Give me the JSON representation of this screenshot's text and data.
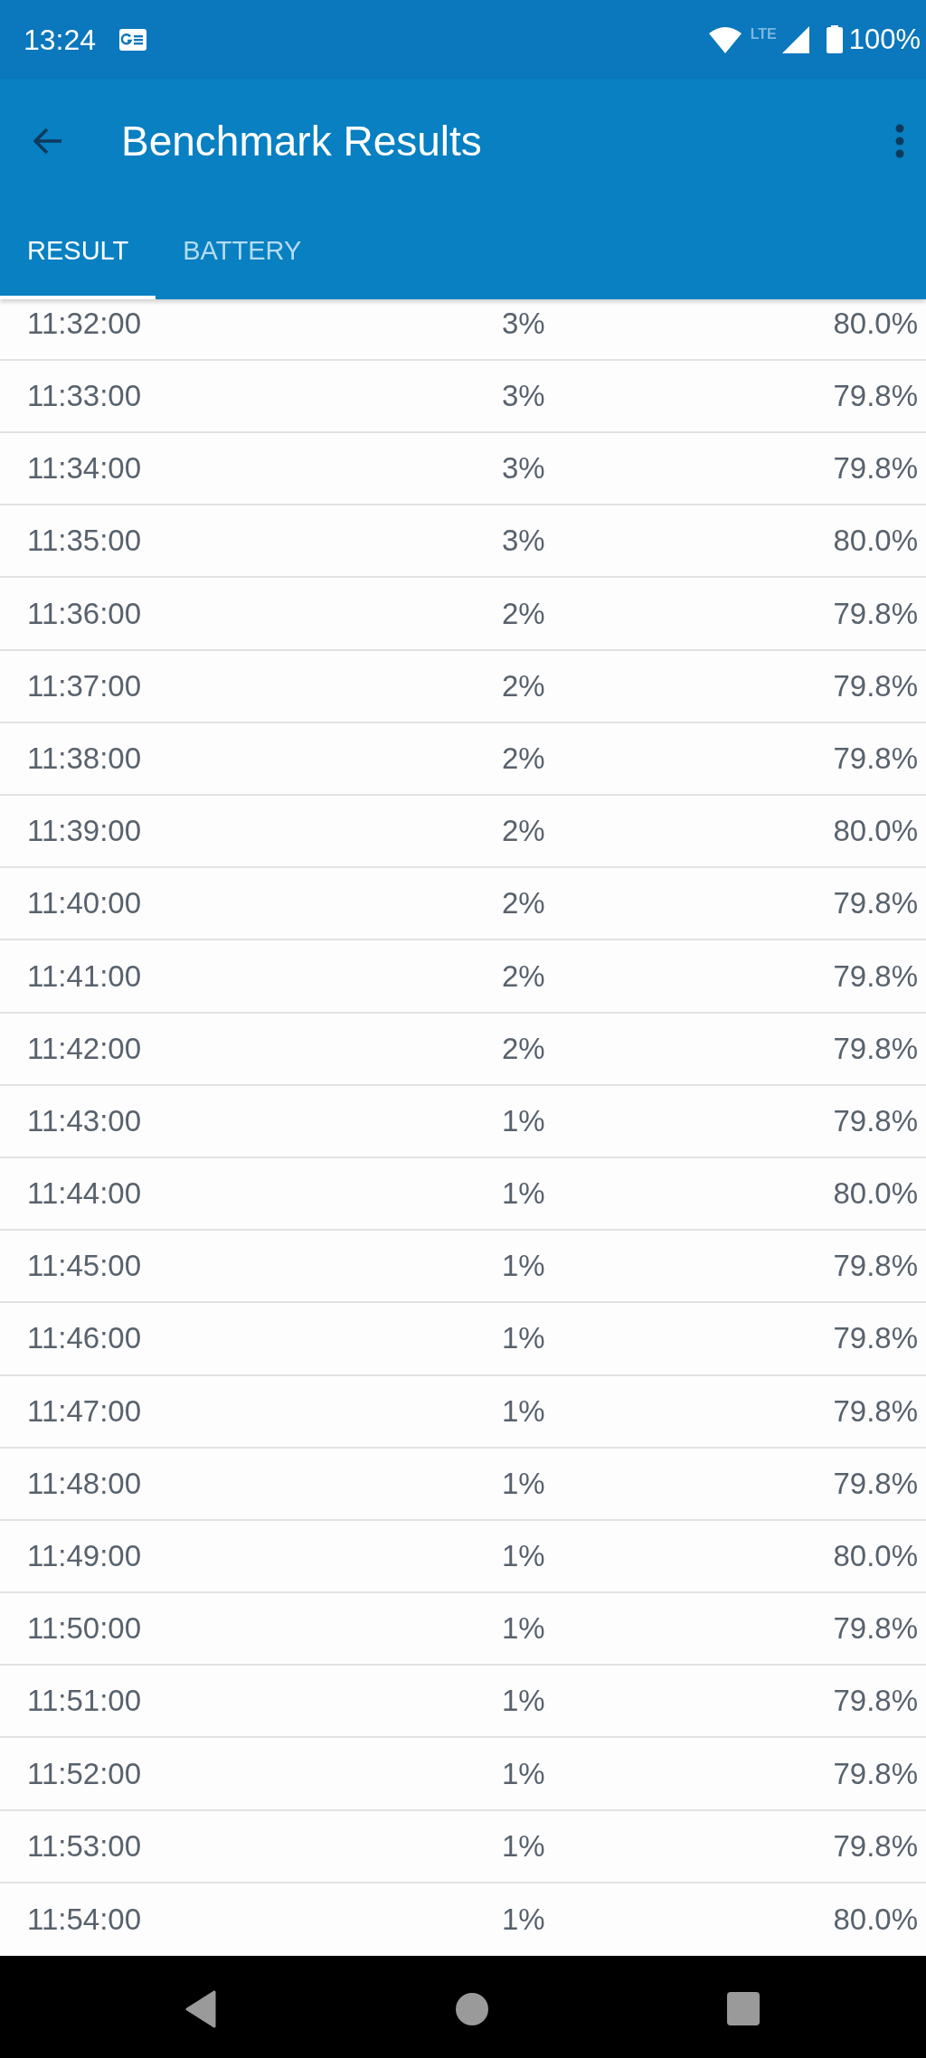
{
  "status_bar": {
    "time": "13:24",
    "network": "LTE",
    "battery": "100%"
  },
  "app_bar": {
    "title": "Benchmark Results"
  },
  "tabs": [
    {
      "label": "RESULT",
      "selected": true
    },
    {
      "label": "BATTERY",
      "selected": false
    }
  ],
  "table": {
    "rows": [
      [
        "11:32:00",
        "3%",
        "80.0%"
      ],
      [
        "11:33:00",
        "3%",
        "79.8%"
      ],
      [
        "11:34:00",
        "3%",
        "79.8%"
      ],
      [
        "11:35:00",
        "3%",
        "80.0%"
      ],
      [
        "11:36:00",
        "2%",
        "79.8%"
      ],
      [
        "11:37:00",
        "2%",
        "79.8%"
      ],
      [
        "11:38:00",
        "2%",
        "79.8%"
      ],
      [
        "11:39:00",
        "2%",
        "80.0%"
      ],
      [
        "11:40:00",
        "2%",
        "79.8%"
      ],
      [
        "11:41:00",
        "2%",
        "79.8%"
      ],
      [
        "11:42:00",
        "2%",
        "79.8%"
      ],
      [
        "11:43:00",
        "1%",
        "79.8%"
      ],
      [
        "11:44:00",
        "1%",
        "80.0%"
      ],
      [
        "11:45:00",
        "1%",
        "79.8%"
      ],
      [
        "11:46:00",
        "1%",
        "79.8%"
      ],
      [
        "11:47:00",
        "1%",
        "79.8%"
      ],
      [
        "11:48:00",
        "1%",
        "79.8%"
      ],
      [
        "11:49:00",
        "1%",
        "80.0%"
      ],
      [
        "11:50:00",
        "1%",
        "79.8%"
      ],
      [
        "11:51:00",
        "1%",
        "79.8%"
      ],
      [
        "11:52:00",
        "1%",
        "79.8%"
      ],
      [
        "11:53:00",
        "1%",
        "79.8%"
      ],
      [
        "11:54:00",
        "1%",
        "80.0%"
      ]
    ]
  }
}
